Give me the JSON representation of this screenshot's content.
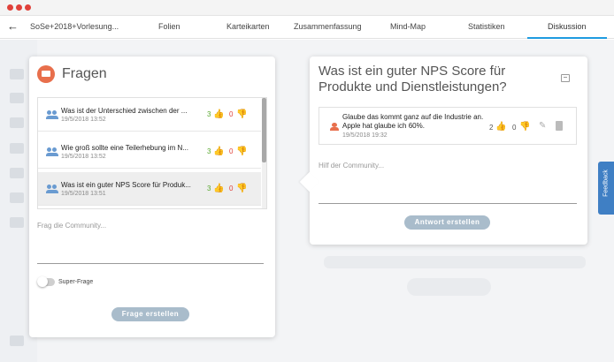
{
  "window": {
    "dot_color": "#e0413a"
  },
  "nav": {
    "course": "SoSe+2018+Vorlesung...",
    "tabs": [
      {
        "label": "Folien"
      },
      {
        "label": "Karteikarten"
      },
      {
        "label": "Zusammenfassung"
      },
      {
        "label": "Mind-Map"
      },
      {
        "label": "Statistiken"
      },
      {
        "label": "Diskussion",
        "active": true
      }
    ]
  },
  "left_panel": {
    "title": "Fragen",
    "questions": [
      {
        "text": "Was ist der Unterschied zwischen der ...",
        "date": "19/5/2018 13:52",
        "upvotes": "3",
        "downvotes": "0"
      },
      {
        "text": "Wie groß sollte eine Teilerhebung im N...",
        "date": "19/5/2018 13:52",
        "upvotes": "3",
        "downvotes": "0"
      },
      {
        "text": "Was ist ein guter NPS Score für Produk...",
        "date": "19/5/2018 13:51",
        "upvotes": "3",
        "downvotes": "0",
        "selected": true
      }
    ],
    "ask_placeholder": "Frag die Community...",
    "super_question_label": "Super-Frage",
    "submit_label": "Frage erstellen"
  },
  "right_panel": {
    "question_title": "Was ist ein guter NPS Score für Produkte und Dienstleistungen?",
    "answer": {
      "text": "Glaube das kommt ganz auf die Industrie an. Apple hat glaube ich 60%.",
      "date": "19/5/2018 19:32",
      "upvotes": "2",
      "downvotes": "0"
    },
    "help_placeholder": "Hilf der Community...",
    "submit_label": "Antwort erstellen"
  },
  "feedback_label": "Feedback",
  "colors": {
    "accent": "#1e9be0",
    "upvote": "#5aa830",
    "downvote": "#e0413a",
    "brand": "#e86f4c",
    "button": "#a9bccb"
  }
}
